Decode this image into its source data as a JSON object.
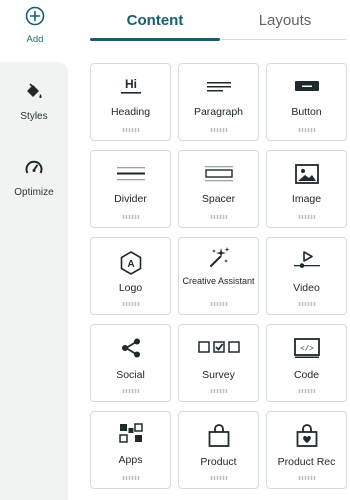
{
  "rail": {
    "add": {
      "label": "Add",
      "icon": "plus-circle-icon"
    },
    "styles": {
      "label": "Styles",
      "icon": "paint-bucket-icon"
    },
    "optimize": {
      "label": "Optimize",
      "icon": "gauge-icon"
    }
  },
  "tabs": [
    {
      "label": "Content",
      "active": true
    },
    {
      "label": "Layouts",
      "active": false
    }
  ],
  "tiles": [
    {
      "label": "Heading",
      "icon": "heading-icon"
    },
    {
      "label": "Paragraph",
      "icon": "paragraph-icon"
    },
    {
      "label": "Button",
      "icon": "button-icon"
    },
    {
      "label": "Divider",
      "icon": "divider-icon"
    },
    {
      "label": "Spacer",
      "icon": "spacer-icon"
    },
    {
      "label": "Image",
      "icon": "image-icon"
    },
    {
      "label": "Logo",
      "icon": "logo-icon"
    },
    {
      "label": "Creative Assistant",
      "icon": "sparkle-wand-icon"
    },
    {
      "label": "Video",
      "icon": "video-icon"
    },
    {
      "label": "Social",
      "icon": "share-icon"
    },
    {
      "label": "Survey",
      "icon": "survey-icon"
    },
    {
      "label": "Code",
      "icon": "code-icon"
    },
    {
      "label": "Apps",
      "icon": "apps-icon"
    },
    {
      "label": "Product",
      "icon": "shopping-bag-icon"
    },
    {
      "label": "Product Rec",
      "icon": "product-rec-icon"
    }
  ],
  "colors": {
    "accent": "#14606d",
    "rail_bg": "#f1f3f3",
    "tile_border": "#d5dadb"
  }
}
